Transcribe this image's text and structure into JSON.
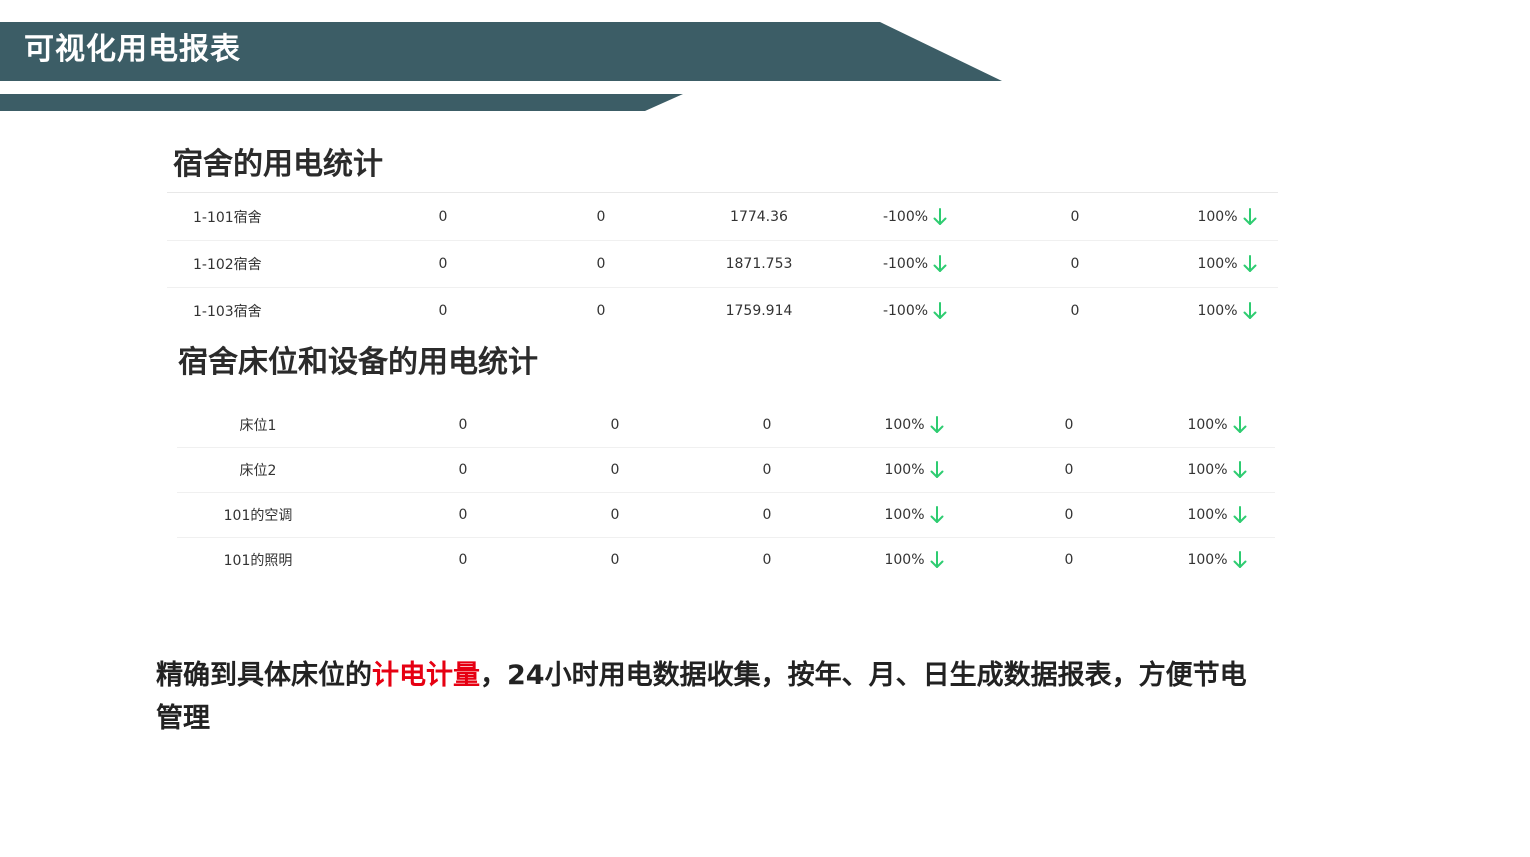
{
  "header": {
    "title": "可视化用电报表"
  },
  "dorm_section": {
    "title": "宿舍的用电统计",
    "rows": [
      {
        "name": "1-101宿舍",
        "v1": "0",
        "v2": "0",
        "v3": "1774.36",
        "change1": "-100%",
        "v4": "0",
        "change2": "100%"
      },
      {
        "name": "1-102宿舍",
        "v1": "0",
        "v2": "0",
        "v3": "1871.753",
        "change1": "-100%",
        "v4": "0",
        "change2": "100%"
      },
      {
        "name": "1-103宿舍",
        "v1": "0",
        "v2": "0",
        "v3": "1759.914",
        "change1": "-100%",
        "v4": "0",
        "change2": "100%"
      }
    ]
  },
  "device_section": {
    "title": "宿舍床位和设备的用电统计",
    "rows": [
      {
        "name": "床位1",
        "v1": "0",
        "v2": "0",
        "v3": "0",
        "change1": "100%",
        "v4": "0",
        "change2": "100%"
      },
      {
        "name": "床位2",
        "v1": "0",
        "v2": "0",
        "v3": "0",
        "change1": "100%",
        "v4": "0",
        "change2": "100%"
      },
      {
        "name": "101的空调",
        "v1": "0",
        "v2": "0",
        "v3": "0",
        "change1": "100%",
        "v4": "0",
        "change2": "100%"
      },
      {
        "name": "101的照明",
        "v1": "0",
        "v2": "0",
        "v3": "0",
        "change1": "100%",
        "v4": "0",
        "change2": "100%"
      }
    ]
  },
  "footer": {
    "text_before": "精确到具体床位的",
    "highlight": "计电计量",
    "text_after": "，24小时用电数据收集，按年、月、日生成数据报表，方便节电管理"
  },
  "colors": {
    "banner": "#3c5d66",
    "highlight": "#e60012",
    "arrow": "#2ecc71"
  },
  "icons": {
    "trend": "arrow-down-icon"
  }
}
